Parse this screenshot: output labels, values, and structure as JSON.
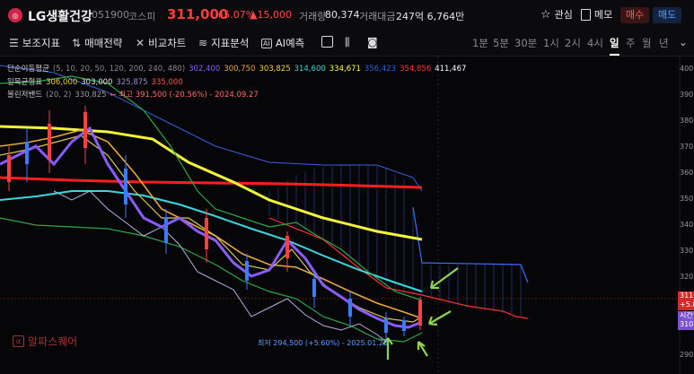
{
  "header": {
    "name": "LG생활건강",
    "code": "051900",
    "market": "코스피",
    "price": "311,000",
    "change_pct": "+5.07%",
    "change_amt": "▲15,000",
    "volume_label": "거래량",
    "volume": "80,374",
    "amount_label": "거래대금",
    "amount": "247억 6,764만",
    "watch_label": "관심",
    "memo_label": "메모",
    "buy_label": "매수",
    "sell_label": "매도"
  },
  "toolbar": {
    "aux_label": "보조지표",
    "strategy_label": "매매전략",
    "compare_label": "비교차트",
    "analysis_label": "지표분석",
    "ai_label": "AI예측",
    "timeframes": [
      "1분",
      "5분",
      "30분",
      "1시",
      "2시",
      "4시",
      "일",
      "주",
      "월",
      "년"
    ],
    "active_timeframe": "일"
  },
  "legend": {
    "ma_title": "단순이동평균",
    "ma_params": "(5, 10, 20, 50, 120, 200, 240, 480)",
    "ma_values": [
      "302,400",
      "300,750",
      "303,825",
      "314,600",
      "334,671",
      "356,423",
      "354,856",
      "411,467"
    ],
    "ma_colors": [
      "#8a5cff",
      "#e8a840",
      "#f0d040",
      "#40d8d8",
      "#ffff40",
      "#3060e0",
      "#ff3030",
      "#ffffff"
    ],
    "ichimoku_title": "일목균형표",
    "ichimoku_values": [
      "306,000",
      "303,000",
      "325,875",
      "335,000"
    ],
    "ichimoku_colors": [
      "#f0d040",
      "#e6e6e6",
      "#9090d0",
      "#ff5050"
    ],
    "bb_title": "볼린저밴드",
    "bb_params": "(20, 2)",
    "bb_value": "330,825",
    "bb_high_text": "← 최고 391,500 (-20.56%) - 2024.09.27"
  },
  "chart_annotation": {
    "low_text": "최저 294,500 (+5.60%) - 2025.01.20"
  },
  "y_axis": {
    "labels": [
      "400",
      "390",
      "380",
      "370",
      "360",
      "350",
      "340",
      "330",
      "320",
      "310",
      "300",
      "290"
    ]
  },
  "price_tags": {
    "current_price": "311",
    "current_pct": "+5.0",
    "time_label": "시간",
    "time_price": "310"
  },
  "watermark": "알파스퀘어"
}
